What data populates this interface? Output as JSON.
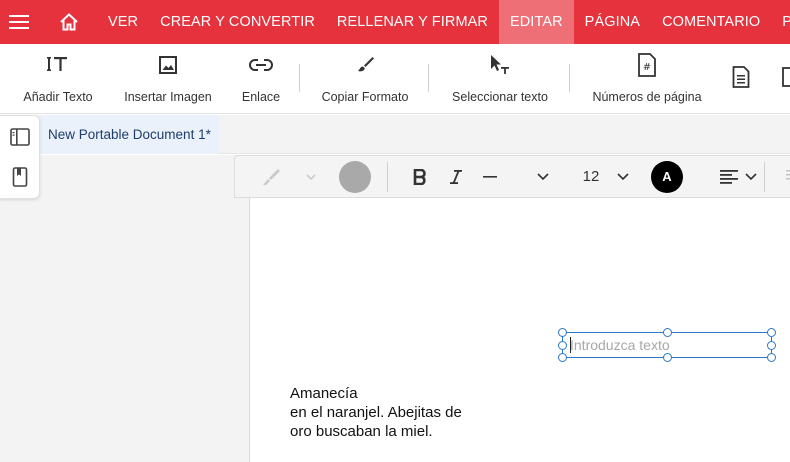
{
  "nav": {
    "tabs": [
      {
        "label": "VER"
      },
      {
        "label": "CREAR Y CONVERTIR"
      },
      {
        "label": "RELLENAR Y FIRMAR"
      },
      {
        "label": "EDITAR"
      },
      {
        "label": "PÁGINA"
      },
      {
        "label": "COMENTARIO"
      },
      {
        "label": "PROTE"
      }
    ],
    "active_tab": "EDITAR"
  },
  "toolbar": {
    "tools": [
      {
        "label": "Añadir Texto",
        "icon": "add-text-icon"
      },
      {
        "label": "Insertar Imagen",
        "icon": "image-icon"
      },
      {
        "label": "Enlace",
        "icon": "link-icon"
      },
      {
        "label": "Copiar Formato",
        "icon": "brush-icon"
      },
      {
        "label": "Seleccionar texto",
        "icon": "select-text-icon"
      },
      {
        "label": "Números de página",
        "icon": "page-number-icon"
      }
    ]
  },
  "document": {
    "tab_title": "New Portable Document 1*",
    "textbox_placeholder": "Introduzca texto",
    "lines": [
      "Amanecía",
      "en el naranjel. Abejitas de",
      "oro buscaban la miel."
    ]
  },
  "format": {
    "font_size": "12",
    "font_color_label": "A"
  },
  "colors": {
    "brand": "#e5323c",
    "active_tab": "#ee6f75",
    "selection": "#2c78c8"
  }
}
